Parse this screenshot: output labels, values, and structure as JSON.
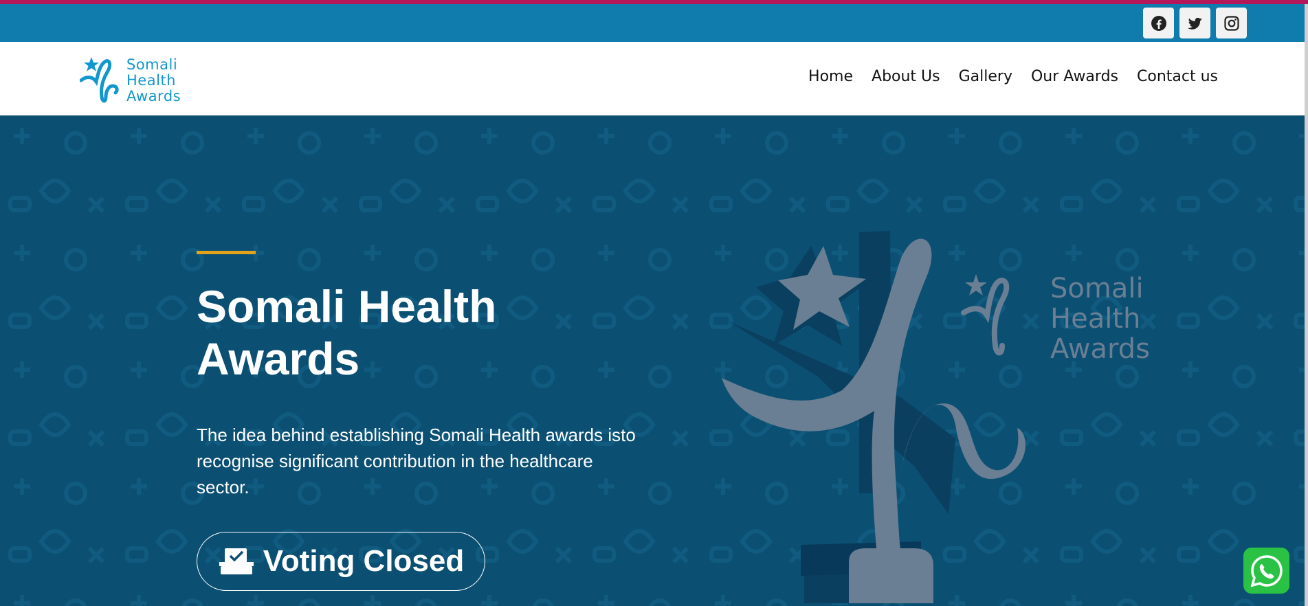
{
  "colors": {
    "top_strip": "#b4185a",
    "topbar": "#0f7cad",
    "hero_bg": "#0b4f73",
    "accent": "#e3a21a",
    "logo_blue": "#1197cf"
  },
  "social": [
    {
      "name": "Facebook",
      "icon": "facebook-icon"
    },
    {
      "name": "Twitter",
      "icon": "twitter-icon"
    },
    {
      "name": "Instagram",
      "icon": "instagram-icon"
    }
  ],
  "logo": {
    "line1": "Somali",
    "line2": "Health",
    "line3": "Awards"
  },
  "nav": {
    "items": [
      "Home",
      "About Us",
      "Gallery",
      "Our Awards",
      "Contact us"
    ]
  },
  "hero": {
    "title": "Somali Health Awards",
    "description": "The idea behind establishing Somali Health awards isto recognise significant contribution in the healthcare sector.",
    "button_label": "Voting Closed",
    "button_icon": "ballot-box-icon"
  },
  "hero_brand": {
    "line1": "Somali",
    "line2": "Health",
    "line3": "Awards"
  },
  "floating": {
    "icon": "whatsapp-icon"
  }
}
